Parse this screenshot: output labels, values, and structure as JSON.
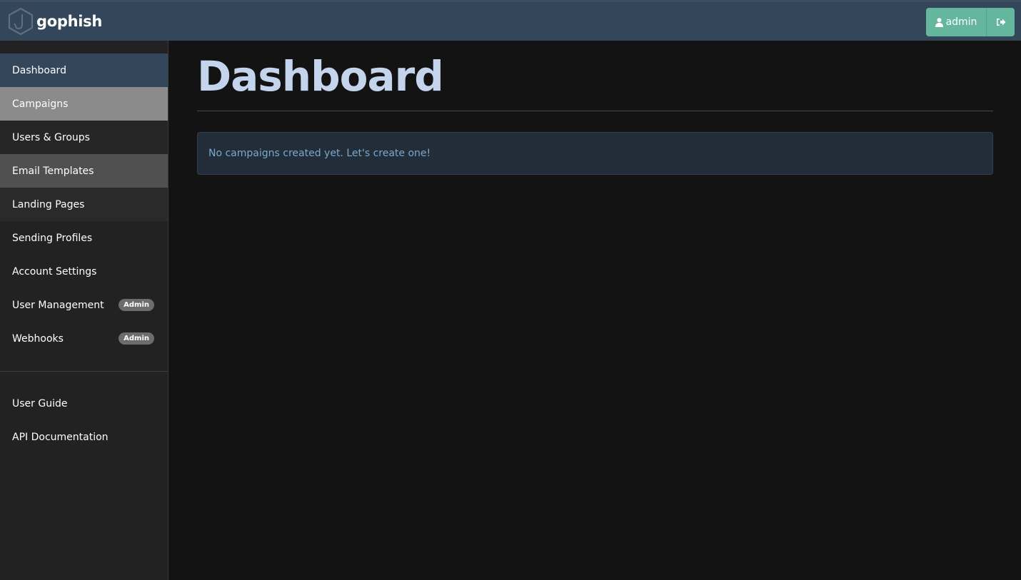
{
  "app": {
    "name": "gophish",
    "logo_icon": "hexagon-hook-icon"
  },
  "header": {
    "user_label": "admin",
    "user_icon": "user-icon",
    "logout_icon": "sign-out-icon"
  },
  "sidebar": {
    "items": [
      {
        "label": "Dashboard",
        "state": "active"
      },
      {
        "label": "Campaigns",
        "state": "hover"
      },
      {
        "label": "Users & Groups"
      },
      {
        "label": "Email Templates"
      },
      {
        "label": "Landing Pages"
      },
      {
        "label": "Sending Profiles"
      },
      {
        "label": "Account Settings"
      },
      {
        "label": "User Management",
        "badge": "Admin"
      },
      {
        "label": "Webhooks",
        "badge": "Admin"
      }
    ],
    "bottom_items": [
      {
        "label": "User Guide"
      },
      {
        "label": "API Documentation"
      }
    ]
  },
  "main": {
    "title": "Dashboard",
    "alert_text": "No campaigns created yet. Let's create one!"
  },
  "colors": {
    "navbar": "#34465a",
    "accent_button": "#64b79d",
    "title": "#c5d4ed",
    "alert_text": "#7ea7c8",
    "sidebar_bg": "#222222",
    "page_bg": "#131313"
  }
}
